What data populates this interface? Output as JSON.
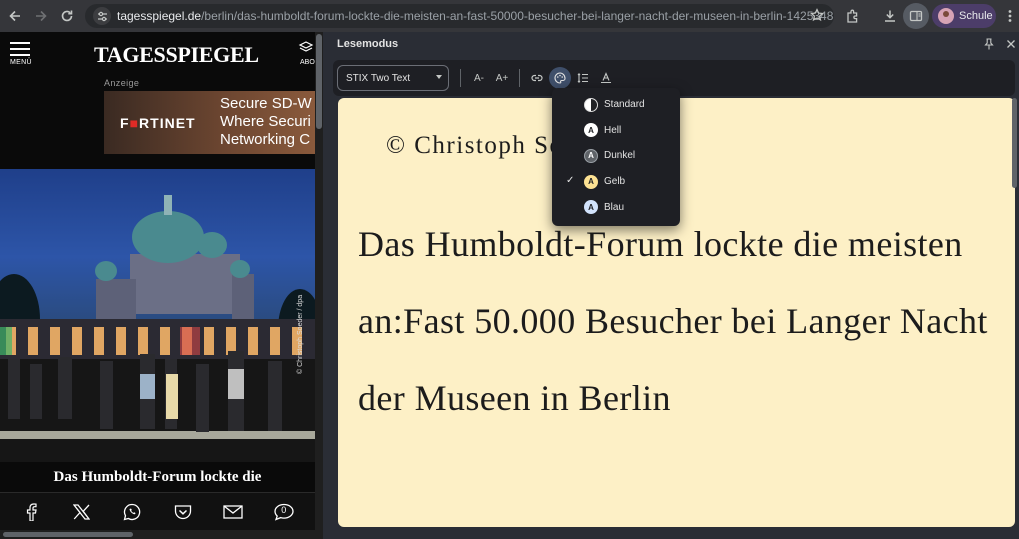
{
  "browser": {
    "url_host": "tagesspiegel.de",
    "url_path": "/berlin/das-humboldt-forum-lockte-die-meisten-an-fast-50000-besucher-bei-langer-nacht-der-museen-in-berlin-14253488.ht...",
    "profile_name": "Schule"
  },
  "webpage": {
    "menu_label": "MENÜ",
    "logo": "TAGESSPIEGEL",
    "abo_label": "ABO",
    "ad_label": "Anzeige",
    "ad_brand_left": "F",
    "ad_brand_red": "■",
    "ad_brand_rest": "RTINET",
    "ad_line1": "Secure SD-W",
    "ad_line2": "Where Securi",
    "ad_line3": "Networking C",
    "photo_credit": "© Christoph Soeder / dpa",
    "article_title": "Das Humboldt-Forum lockte die",
    "share_comment_count": "0"
  },
  "panel": {
    "title": "Lesemodus",
    "font_select_value": "STIX Two Text",
    "font_smaller": "A-",
    "font_larger": "A+",
    "color_menu": {
      "items": [
        {
          "label": "Standard",
          "swatch_letter": "",
          "checked": false
        },
        {
          "label": "Hell",
          "swatch_letter": "A",
          "checked": false
        },
        {
          "label": "Dunkel",
          "swatch_letter": "A",
          "checked": false
        },
        {
          "label": "Gelb",
          "swatch_letter": "A",
          "checked": true
        },
        {
          "label": "Blau",
          "swatch_letter": "A",
          "checked": false
        }
      ],
      "check_mark": "✓"
    },
    "reader": {
      "credit": "© Christoph Soeder / dpa",
      "headline": "Das Humboldt-Forum lockte die meisten an:Fast 50.000 Besucher bei Langer Nacht der Museen in Berlin",
      "background_color": "#fdf0c6"
    }
  },
  "icons": {
    "back": "back-arrow-icon",
    "forward": "forward-arrow-icon",
    "reload": "reload-icon",
    "site_info": "tune-icon",
    "bookmark": "star-icon",
    "extensions": "puzzle-icon",
    "download": "download-icon",
    "side_panel": "reading-mode-icon",
    "menu": "three-dots-icon"
  }
}
